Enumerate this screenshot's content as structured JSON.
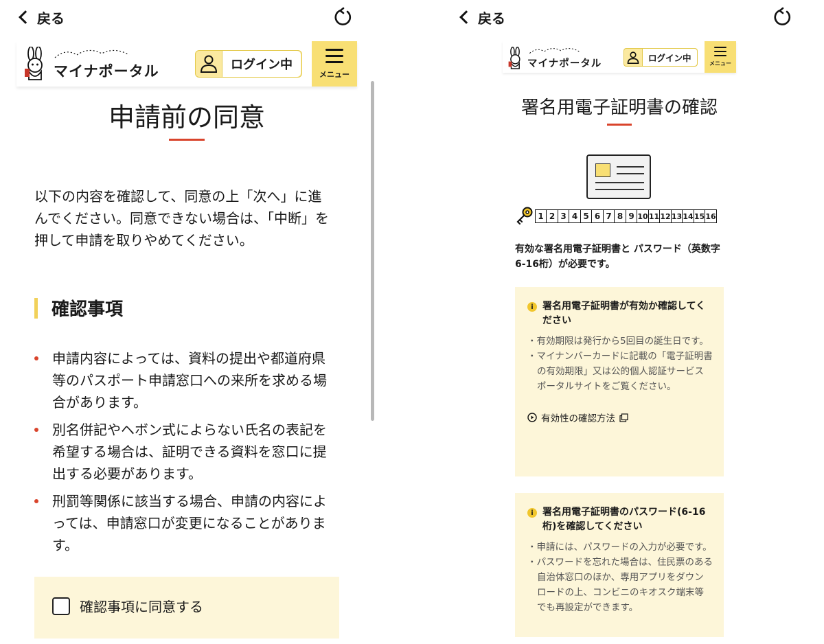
{
  "left": {
    "back_label": "戻る",
    "logo_text": "マイナポータル",
    "login_label": "ログイン中",
    "menu_label": "メニュー",
    "title": "申請前の同意",
    "intro": "以下の内容を確認して、同意の上「次へ」に進んでください。同意できない場合は、「中断」を押して申請を取りやめてください。",
    "section_heading": "確認事項",
    "bullets": [
      "申請内容によっては、資料の提出や都道府県等のパスポート申請窓口への来所を求める場合があります。",
      "別名併記やヘボン式によらない氏名の表記を希望する場合は、証明できる資料を窓口に提出する必要があります。",
      "刑罰等関係に該当する場合、申請の内容によっては、申請窓口が変更になることがあります。"
    ],
    "agree_label": "確認事項に同意する"
  },
  "right": {
    "back_label": "戻る",
    "logo_text": "マイナポータル",
    "login_label": "ログイン中",
    "menu_label": "メニュー",
    "title": "署名用電子証明書の確認",
    "digits": [
      "1",
      "2",
      "3",
      "4",
      "5",
      "6",
      "7",
      "8",
      "9",
      "10",
      "11",
      "12",
      "13",
      "14",
      "15",
      "16"
    ],
    "requirement": "有効な署名用電子証明書と パスワード（英数字6-16桁）が必要です。",
    "panel1": {
      "heading": "署名用電子証明書が有効か確認してください",
      "bullets": [
        "・有効期限は発行から5回目の誕生日です。",
        "・マイナンバーカードに記載の「電子証明書の有効期限」又は公的個人認証サービスポータルサイトをご覧ください。"
      ],
      "link_label": "有効性の確認方法"
    },
    "panel2": {
      "heading": "署名用電子証明書のパスワード(6-16桁)を確認してください",
      "bullets": [
        "・申請には、パスワードの入力が必要です。",
        "・パスワードを忘れた場合は、住民票のある自治体窓口のほか、専用アプリをダウンロードの上、コンビニのキオスク端末等でも再設定ができます。"
      ]
    }
  },
  "colors": {
    "accent_yellow": "#f8df74",
    "panel_bg": "#fdf6d9",
    "red_accent": "#d9442c",
    "bullet_red": "#d9442c"
  }
}
